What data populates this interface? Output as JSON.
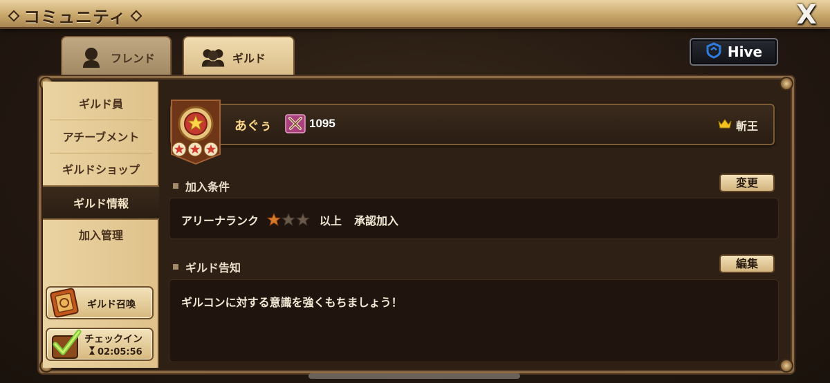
{
  "window": {
    "title": "コミュニティ",
    "close_symbol": "X"
  },
  "tabs": [
    {
      "label": "フレンド",
      "icon": "person-icon",
      "active": false
    },
    {
      "label": "ギルド",
      "icon": "group-icon",
      "active": true
    }
  ],
  "hive_button": {
    "label": "Hive",
    "icon": "hive-shield-icon"
  },
  "sidebar": {
    "items": [
      {
        "label": "ギルド員",
        "active": false
      },
      {
        "label": "アチーブメント",
        "active": false
      },
      {
        "label": "ギルドショップ",
        "active": false
      },
      {
        "label": "ギルド情報",
        "active": true
      },
      {
        "label": "加入管理",
        "active": false
      }
    ],
    "summon_button": {
      "label": "ギルド召喚",
      "icon": "summon-scroll-icon"
    },
    "checkin_button": {
      "label": "チェックイン",
      "timer": "02:05:56",
      "timer_icon": "hourglass-icon",
      "icon": "checkmark-icon"
    }
  },
  "guild": {
    "name": "あぐぅ",
    "points": "1095",
    "points_icon": "crossed-swords-icon",
    "leader": "斬王",
    "leader_icon": "crown-icon",
    "emblem_icon": "guild-emblem-star-icon",
    "emblem_stars": 3
  },
  "join_conditions": {
    "heading": "加入条件",
    "change_button": "変更",
    "arena_rank_label": "アリーナランク",
    "arena_rank_stars": 3,
    "arena_rank_filled": 1,
    "qualifier": "以上",
    "approval": "承認加入"
  },
  "guild_notice": {
    "heading": "ギルド告知",
    "edit_button": "編集",
    "text": "ギルコンに対する意識を強くもちましょう！"
  },
  "colors": {
    "accent_gold": "#ffd98b",
    "panel_dark": "#2e2015",
    "sidebar_light": "#ead3a2",
    "hive_blue": "#2f7de1"
  }
}
